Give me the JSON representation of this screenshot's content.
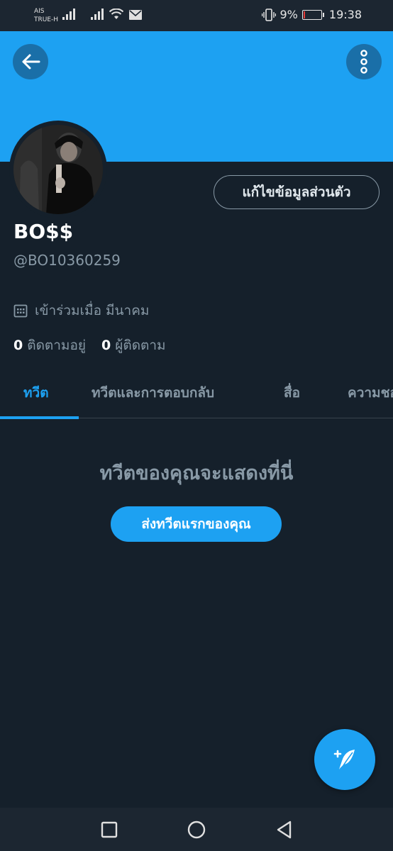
{
  "status_bar": {
    "carrier_line1": "AIS",
    "carrier_line2": "TRUE-H",
    "battery_percent": "9%",
    "battery_level": 0.09,
    "time": "19:38",
    "icons": [
      "signal-icon",
      "signal-icon",
      "wifi-icon",
      "mail-icon",
      "vibrate-icon",
      "battery-icon"
    ]
  },
  "header": {
    "back_icon": "arrow-left-icon",
    "more_icon": "more-vertical-icon",
    "banner_color": "#1da1f2"
  },
  "profile": {
    "edit_button": "แก้ไขข้อมูลส่วนตัว",
    "display_name": "BO$$",
    "handle": "@BO10360259",
    "joined_icon": "calendar-icon",
    "joined": "เข้าร่วมเมื่อ มีนาคม",
    "following_count": "0",
    "following_label": "ติดตามอยู่",
    "followers_count": "0",
    "followers_label": "ผู้ติดตาม"
  },
  "tabs": [
    {
      "label": "ทวีต",
      "active": true
    },
    {
      "label": "ทวีตและการตอบกลับ",
      "active": false
    },
    {
      "label": "สื่อ",
      "active": false
    },
    {
      "label": "ความชอ",
      "active": false
    }
  ],
  "empty_state": {
    "title": "ทวีตของคุณจะแสดงที่นี่",
    "button": "ส่งทวีตแรกของคุณ"
  },
  "fab": {
    "icon": "compose-tweet-icon"
  },
  "nav_bar": {
    "icons": [
      "recent-apps-icon",
      "home-icon",
      "back-icon"
    ]
  },
  "colors": {
    "accent": "#1da1f2",
    "background": "#15202b",
    "secondary_text": "#8899a6"
  }
}
